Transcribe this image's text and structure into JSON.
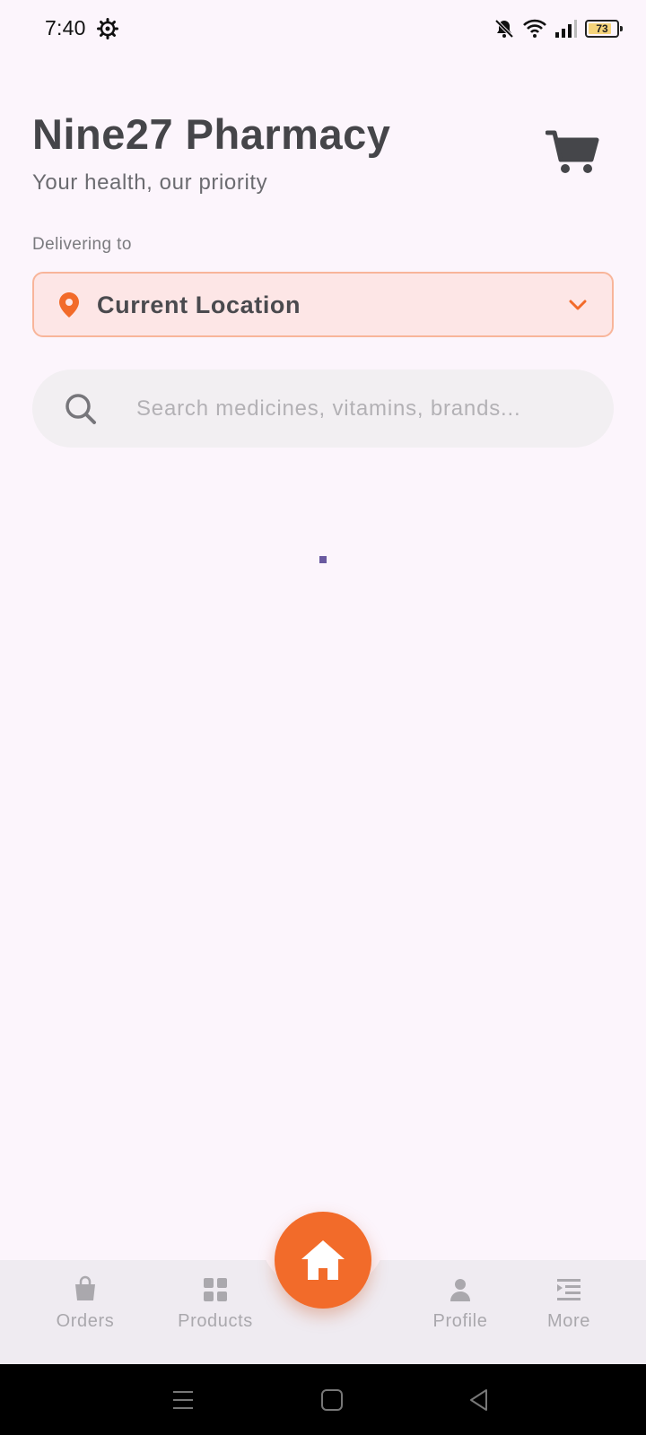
{
  "status_bar": {
    "time": "7:40",
    "battery_level": "73",
    "icons": [
      "settings-gear-icon",
      "bell-off-icon",
      "wifi-icon",
      "signal-icon",
      "battery-icon"
    ]
  },
  "header": {
    "title": "Nine27 Pharmacy",
    "subtitle": "Your health, our priority",
    "cart_icon": "cart-icon"
  },
  "delivery": {
    "label": "Delivering to",
    "location": "Current Location",
    "pin_icon": "location-pin-icon",
    "chevron_icon": "chevron-down-icon"
  },
  "search": {
    "placeholder": "Search medicines, vitamins, brands...",
    "value": ""
  },
  "bottom_nav": {
    "items": [
      {
        "label": "Orders",
        "icon": "shopping-bag-icon"
      },
      {
        "label": "Products",
        "icon": "grid-icon"
      },
      {
        "label": "Profile",
        "icon": "person-icon"
      },
      {
        "label": "More",
        "icon": "menu-list-icon"
      }
    ],
    "center_icon": "home-icon"
  },
  "colors": {
    "accent": "#f26b2a",
    "background": "#fcf5fc",
    "location_bg": "#fde6e6",
    "location_border": "#f8b59a",
    "nav_bg": "#efebf1",
    "inactive": "#aaa8ad"
  }
}
